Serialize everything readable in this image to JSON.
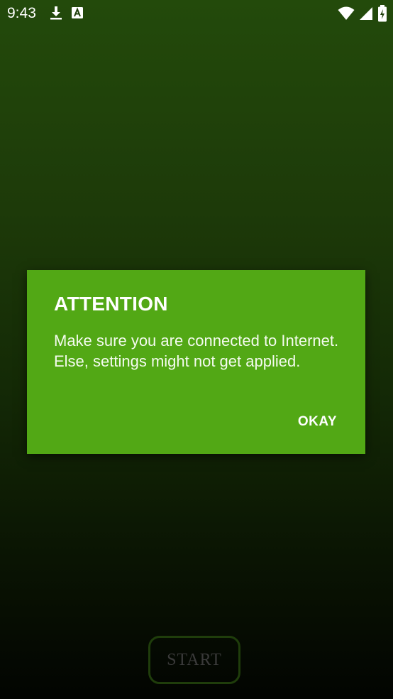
{
  "status_bar": {
    "time": "9:43",
    "left_icons": [
      "download-icon",
      "text-a-icon"
    ],
    "right_icons": [
      "wifi-icon",
      "signal-icon",
      "battery-icon"
    ]
  },
  "dialog": {
    "title": "ATTENTION",
    "message": "Make sure you are connected to Internet.\nElse, settings might not get applied.",
    "button_label": "OKAY",
    "background_color": "#52a815"
  },
  "main": {
    "start_label": "START"
  }
}
